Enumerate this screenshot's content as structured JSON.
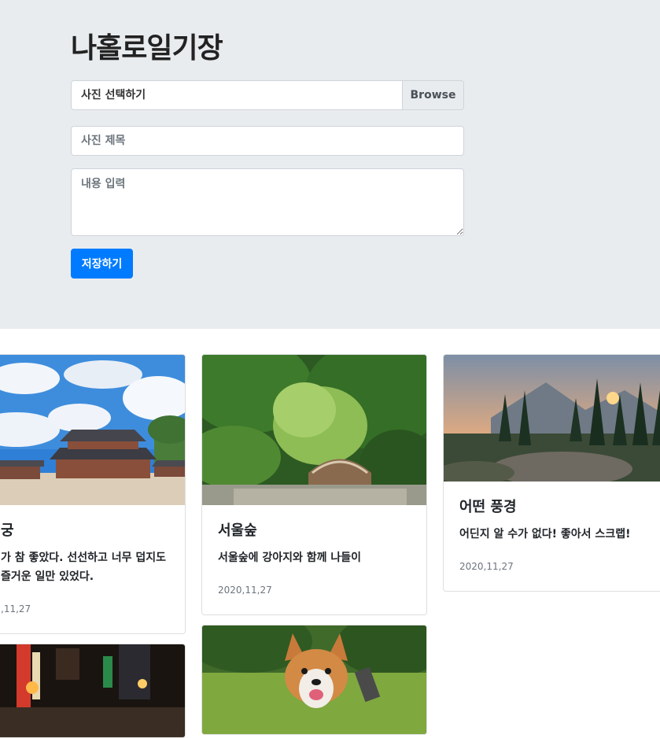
{
  "header": {
    "title": "나홀로일기장",
    "file_label": "사진 선택하기",
    "browse_label": "Browse",
    "title_placeholder": "사진 제목",
    "content_placeholder": "내용 입력",
    "save_label": "저장하기"
  },
  "cards": [
    {
      "title": "궁",
      "text_line1": "가 참 좋았다. 선선하고 너무 덥지도",
      "text_line2": "즐거운 일만 있었다.",
      "date": ",11,27"
    },
    {
      "title": "서울숲",
      "text_line1": "서울숲에 강아지와 함께 나들이",
      "date": "2020,11,27"
    },
    {
      "title": "어떤 풍경",
      "text_line1": "어딘지 알 수가 없다! 좋아서 스크랩!",
      "date": "2020,11,27"
    }
  ],
  "icons": [
    "palace-photo",
    "forest-photo",
    "mountain-photo",
    "street-photo",
    "dog-photo"
  ],
  "colors": {
    "jumbotron": "#e9ecef",
    "primary": "#007bff"
  }
}
